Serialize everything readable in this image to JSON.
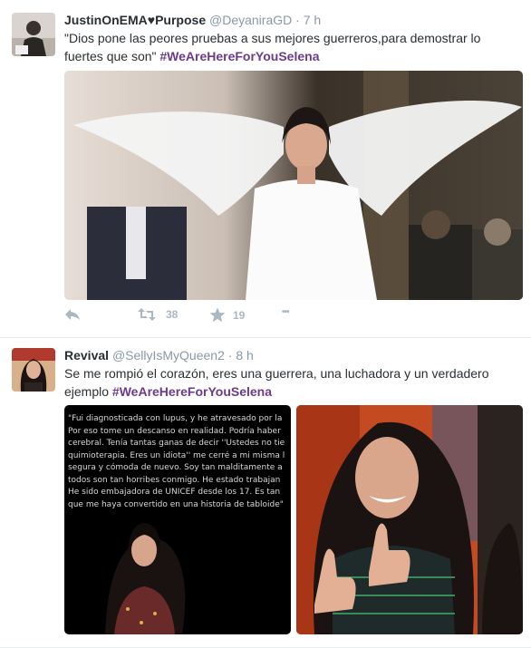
{
  "tweets": [
    {
      "name": "JustinOnEMA♥Purpose",
      "handle": "@DeyaniraGD",
      "sep": "·",
      "time": "7 h",
      "text_line1": "\"Dios pone las peores pruebas a sus mejores guerreros,para demostrar lo",
      "text_line2": "fuertes que son\"",
      "hashtag": "#WeAreHereForYouSelena",
      "retweets": "38",
      "likes": "19",
      "more": "•••"
    },
    {
      "name": "Revival",
      "handle": "@SellyIsMyQueen2",
      "sep": "·",
      "time": "8 h",
      "text_line1": "Se me rompió el corazón, eres una guerrera, una luchadora y un verdadero",
      "text_line2": "ejemplo",
      "hashtag": "#WeAreHereForYouSelena",
      "quote_lines": [
        "\"Fui diagnosticada con lupus, y he atravesado por la",
        "Por eso tome un descanso en realidad. Podría haber",
        "cerebral. Tenía tantas ganas de decir ''Ustedes no tie",
        "quimioterapia. Eres un idiota'' me cerré a mi misma l",
        "segura y cómoda de nuevo. Soy tan malditamente a",
        "todos son tan horribes conmigo. He estado trabajan",
        "He sido embajadora de UNICEF desde los 17. Es tan",
        "que me haya convertido en una historia de tabloide\""
      ]
    }
  ],
  "colors": {
    "hashtag": "#6b3a8e",
    "meta": "#8899a6",
    "action": "#aab8c2"
  }
}
